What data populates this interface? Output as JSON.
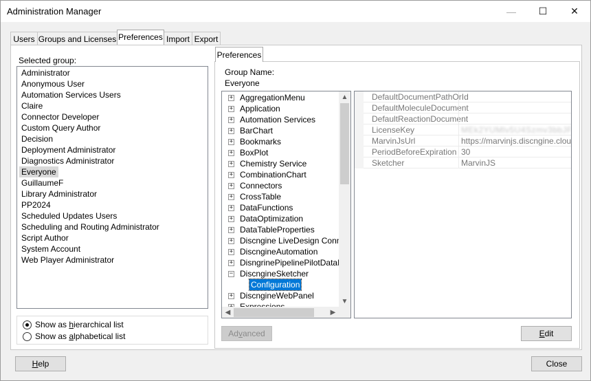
{
  "window": {
    "title": "Administration Manager",
    "controls": {
      "minimize": "—",
      "maximize": "☐",
      "close": "✕"
    }
  },
  "tabs": [
    {
      "label": "Users",
      "active": false
    },
    {
      "label": "Groups and Licenses",
      "active": false
    },
    {
      "label": "Preferences",
      "active": true
    },
    {
      "label": "Import",
      "active": false
    },
    {
      "label": "Export",
      "active": false
    }
  ],
  "left": {
    "selected_group_label": "Selected group:",
    "groups": [
      "Administrator",
      "Anonymous User",
      "Automation Services Users",
      "Claire",
      "Connector Developer",
      "Custom Query Author",
      "Decision",
      "Deployment Administrator",
      "Diagnostics Administrator",
      "Everyone",
      "GuillaumeF",
      "Library Administrator",
      "PP2024",
      "Scheduled Updates Users",
      "Scheduling and Routing Administrator",
      "Script Author",
      "System Account",
      "Web Player Administrator"
    ],
    "selected_index": 9,
    "radio_hierarchical": {
      "pre": "Show as ",
      "u": "h",
      "post": "ierarchical list"
    },
    "radio_alphabetical": {
      "pre": "Show as ",
      "u": "a",
      "post": "lphabetical list"
    }
  },
  "prefs": {
    "inner_tab": "Preferences",
    "group_name_label": "Group Name:",
    "group_name_value": "Everyone",
    "tree": [
      {
        "label": "AggregationMenu",
        "exp": "+"
      },
      {
        "label": "Application",
        "exp": "+"
      },
      {
        "label": "Automation Services",
        "exp": "+"
      },
      {
        "label": "BarChart",
        "exp": "+"
      },
      {
        "label": "Bookmarks",
        "exp": "+"
      },
      {
        "label": "BoxPlot",
        "exp": "+"
      },
      {
        "label": "Chemistry Service",
        "exp": "+"
      },
      {
        "label": "CombinationChart",
        "exp": "+"
      },
      {
        "label": "Connectors",
        "exp": "+"
      },
      {
        "label": "CrossTable",
        "exp": "+"
      },
      {
        "label": "DataFunctions",
        "exp": "+"
      },
      {
        "label": "DataOptimization",
        "exp": "+"
      },
      {
        "label": "DataTableProperties",
        "exp": "+"
      },
      {
        "label": "Discngine LiveDesign Connect",
        "exp": "+"
      },
      {
        "label": "DiscngineAutomation",
        "exp": "+"
      },
      {
        "label": "DisngrinePipelinePilotDataFun",
        "exp": "+"
      },
      {
        "label": "DiscngineSketcher",
        "exp": "−"
      },
      {
        "label": "Configuration",
        "exp": "",
        "child": true,
        "selected": true
      },
      {
        "label": "DiscngineWebPanel",
        "exp": "+"
      },
      {
        "label": "Expressions",
        "exp": "+"
      }
    ],
    "properties": [
      {
        "key": "DefaultDocumentPathOrId",
        "value": ""
      },
      {
        "key": "DefaultMoleculeDocument",
        "value": ""
      },
      {
        "key": "DefaultReactionDocument",
        "value": ""
      },
      {
        "key": "LicenseKey",
        "value": "MEk2YUMlv5U4Szmv3bbJFUq",
        "blurred": true
      },
      {
        "key": "MarvinJsUrl",
        "value": "https://marvinjs.discngine.cloud/"
      },
      {
        "key": "PeriodBeforeExpiration",
        "value": "30"
      },
      {
        "key": "Sketcher",
        "value": "MarvinJS"
      }
    ],
    "advanced_button": {
      "pre": "Ad",
      "u": "v",
      "post": "anced"
    },
    "edit_button": {
      "pre": "",
      "u": "E",
      "post": "dit"
    }
  },
  "footer": {
    "help_button": {
      "pre": "",
      "u": "H",
      "post": "elp"
    },
    "close_button": "Close"
  }
}
